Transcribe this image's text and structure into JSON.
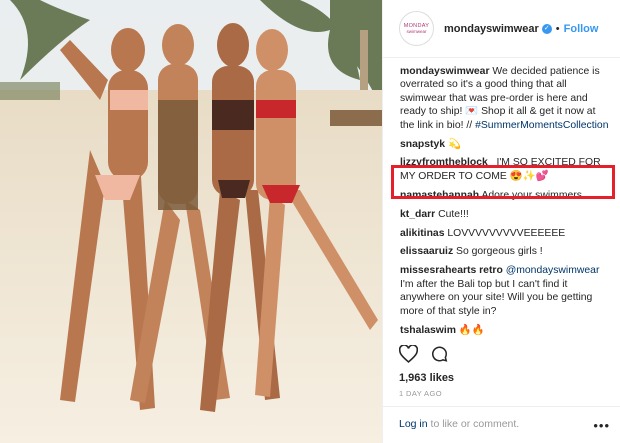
{
  "post": {
    "username": "mondayswimwear",
    "follow_label": "Follow",
    "separator": "•",
    "avatar_text_line1": "MONDAY",
    "avatar_text_line2": "swimwear"
  },
  "caption": {
    "username": "mondayswimwear",
    "text": "We decided patience is overrated so it's a good thing that all swimwear that was pre-order is here and ready to ship! 💌 Shop it all & get it now at the link in bio! //",
    "hashtag": "#SummerMomentsCollection"
  },
  "comments": [
    {
      "username": "snapstyk",
      "text": "💫"
    },
    {
      "username": "lizzyfromtheblock_",
      "text": "I'M SO EXCITED FOR MY ORDER TO COME 😍✨💕"
    },
    {
      "username": "namastehannah",
      "text": "Adore your swimmers"
    },
    {
      "username": "kt_darr",
      "text": "Cute!!!"
    },
    {
      "username": "alikitinas",
      "text": "LOVVVVVVVVVEEEEEE"
    },
    {
      "username": "elissaaruiz",
      "text": "So gorgeous girls !"
    },
    {
      "username": "missesrahearts retro",
      "text_before": "",
      "mention": "@mondayswimwear",
      "text": "I'm after the Bali top but I can't find it anywhere on your site! Will you be getting more of that style in?"
    },
    {
      "username": "tshalaswim",
      "text": "🔥🔥"
    }
  ],
  "likes": "1,963 likes",
  "age": "1 DAY AGO",
  "login": {
    "link": "Log in",
    "rest": " to like or comment."
  },
  "more_label": "•••",
  "icons": {
    "heart": "heart-icon",
    "comment": "comment-icon",
    "verified": "verified-badge-icon"
  },
  "colors": {
    "link_blue": "#3897f0",
    "highlight_red": "#e4212b",
    "hashtag": "#003569"
  }
}
